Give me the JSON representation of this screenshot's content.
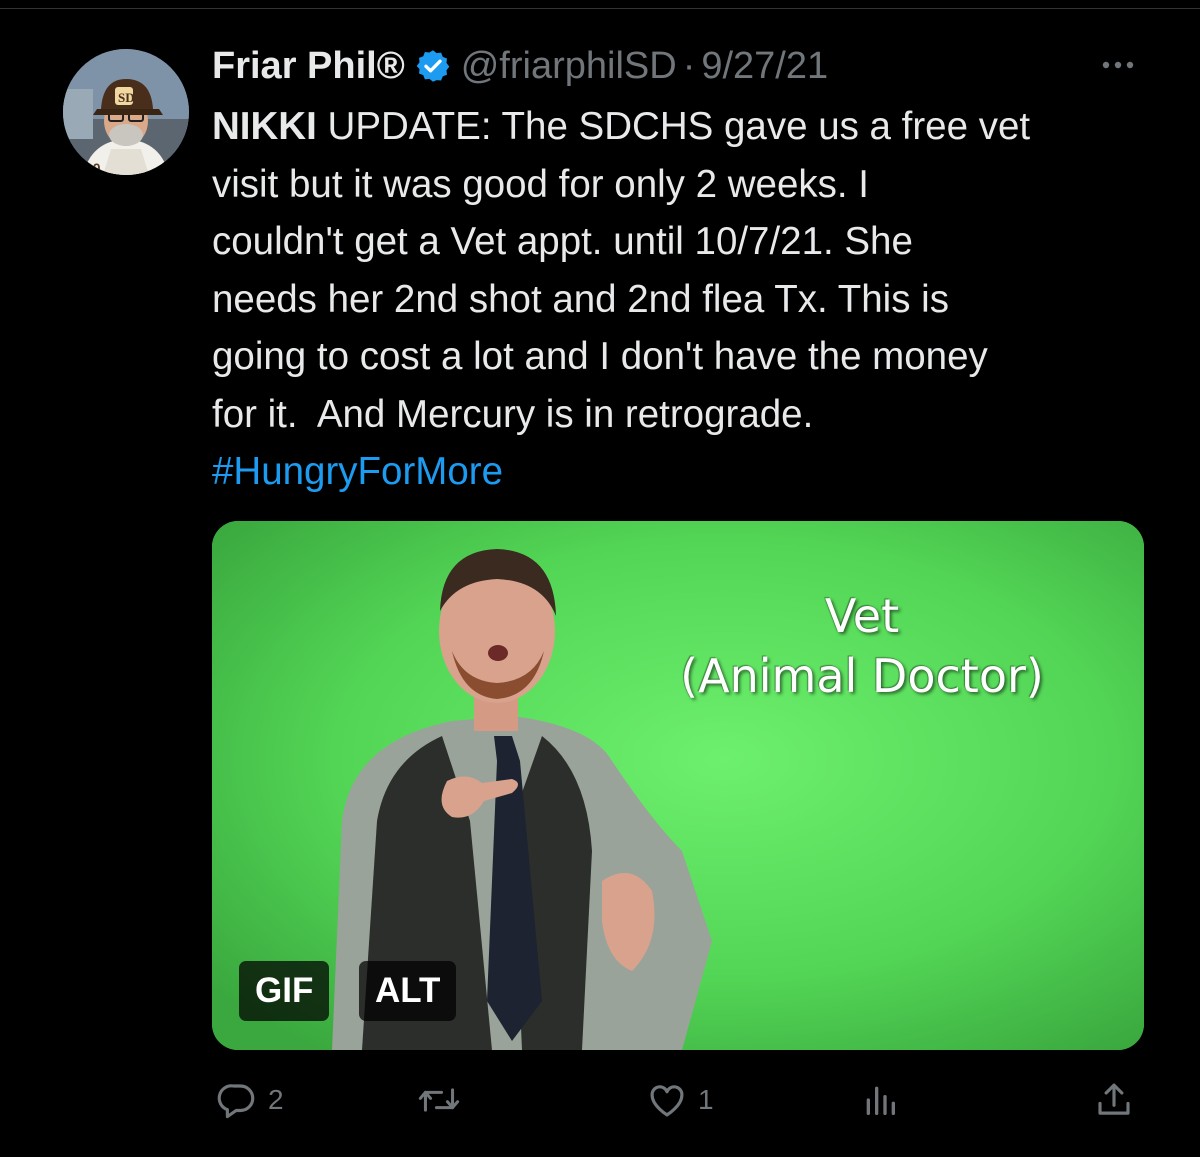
{
  "author": {
    "display_name": "Friar Phil®",
    "handle": "@friarphilSD",
    "separator": "·",
    "date": "9/27/21",
    "verified": true
  },
  "tweet": {
    "text_bold": "NIKKI",
    "text_body": " UPDATE: The SDCHS gave us a free vet\nvisit but it was good for only 2 weeks. I\ncouldn't get a Vet appt. until 10/7/21. She\nneeds her 2nd shot and 2nd flea Tx. This is\ngoing to cost a lot and I don't have the money\nfor it.  And Mercury is in retrograde.",
    "hashtag": "#HungryForMore"
  },
  "media": {
    "caption_line1": "Vet",
    "caption_line2": "(Animal Doctor)",
    "gif_badge": "GIF",
    "alt_badge": "ALT"
  },
  "actions": {
    "reply_count": "2",
    "retweet_count": "",
    "like_count": "1",
    "views_count": ""
  },
  "colors": {
    "background": "#000000",
    "text_primary": "#e7e9ea",
    "text_secondary": "#71767b",
    "link": "#1d9bf0",
    "verified_badge": "#1d9bf0",
    "media_green": "#4fcf55"
  },
  "icons": {
    "more": "more-icon",
    "verified": "verified-icon",
    "reply": "reply-icon",
    "retweet": "retweet-icon",
    "like": "heart-icon",
    "views": "views-icon",
    "share": "share-icon"
  }
}
